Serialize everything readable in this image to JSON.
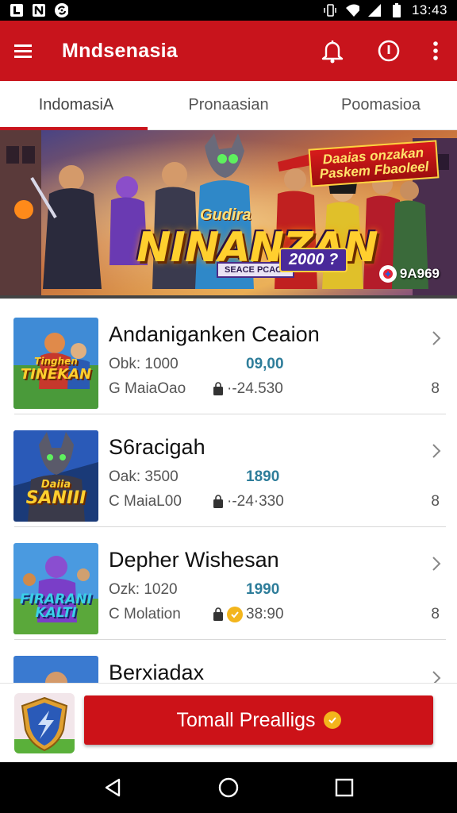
{
  "status_bar": {
    "time": "13:43",
    "left_icons": [
      "notification-icon",
      "sim-icon",
      "sync-icon"
    ],
    "right_icons": [
      "vibrate-icon",
      "wifi-icon",
      "signal-icon",
      "battery-icon"
    ]
  },
  "app_bar": {
    "title": "Mndsenasia",
    "menu_icon": "menu-icon",
    "actions": [
      "bell-icon",
      "info-icon",
      "more-vert-icon"
    ],
    "color": "#c8141c"
  },
  "tabs": [
    {
      "label": "IndomasiA",
      "active": true
    },
    {
      "label": "Pronaasian",
      "active": false
    },
    {
      "label": "Poomasioa",
      "active": false
    }
  ],
  "banner": {
    "tag_line1": "Daaias onzakan",
    "tag_line2": "Paskem Fbaoleel",
    "logo_top": "Gudira",
    "logo": "NINANZAN",
    "subtitle": "SEACE PCACII",
    "year": "2000 ?",
    "counter": "9A969"
  },
  "list": [
    {
      "title": "Andaniganken Ceaion",
      "meta1": "Obk: 1000",
      "value": "09,00",
      "meta2": "G MaiaOao",
      "price": "·-24.530",
      "count": "8",
      "thumb_label": "TINEKAN",
      "thumb_top": "Tinghen"
    },
    {
      "title": "S6racigah",
      "meta1": "Oak: 3500",
      "value": "1890",
      "meta2": "C MaiaL00",
      "price": "·-24·330",
      "count": "8",
      "thumb_label": "SANIII",
      "thumb_top": "Daiia"
    },
    {
      "title": "Depher Wishesan",
      "meta1": "Ozk: 1020",
      "value": "1990",
      "meta2": "C Molation",
      "price": "38:90",
      "count": "8",
      "thumb_label": "FIRARANI KALTI",
      "thumb_top": ""
    },
    {
      "title": "Berxiadax",
      "meta1": "",
      "value": "",
      "meta2": "",
      "price": "",
      "count": "",
      "thumb_label": "",
      "thumb_top": ""
    }
  ],
  "action_bar": {
    "button_label": "Tomall Prealligs",
    "shield_icon": "shield-icon"
  },
  "nav_bar": {
    "items": [
      "back-icon",
      "home-icon",
      "recents-icon"
    ]
  }
}
